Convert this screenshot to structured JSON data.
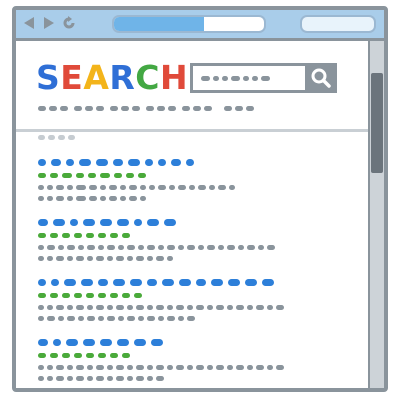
{
  "logo": {
    "letters": [
      "S",
      "E",
      "A",
      "R",
      "C",
      "H"
    ],
    "colors": [
      "#2f6fd6",
      "#e04a3a",
      "#f3b41a",
      "#2f6fd6",
      "#43a843",
      "#e04a3a"
    ]
  },
  "colors": {
    "frame": "#8a949c",
    "titlebar": "#a9cdea",
    "link": "#2d7fd9",
    "url": "#4aaa3a",
    "snippet": "#8a949c",
    "meta": "#c6ccd1"
  },
  "address_bar": {
    "progress": 0.6
  },
  "icons": {
    "back": "triangle-left-icon",
    "forward": "triangle-right-icon",
    "reload": "reload-icon",
    "search": "magnifier-icon"
  },
  "results_count": 4
}
